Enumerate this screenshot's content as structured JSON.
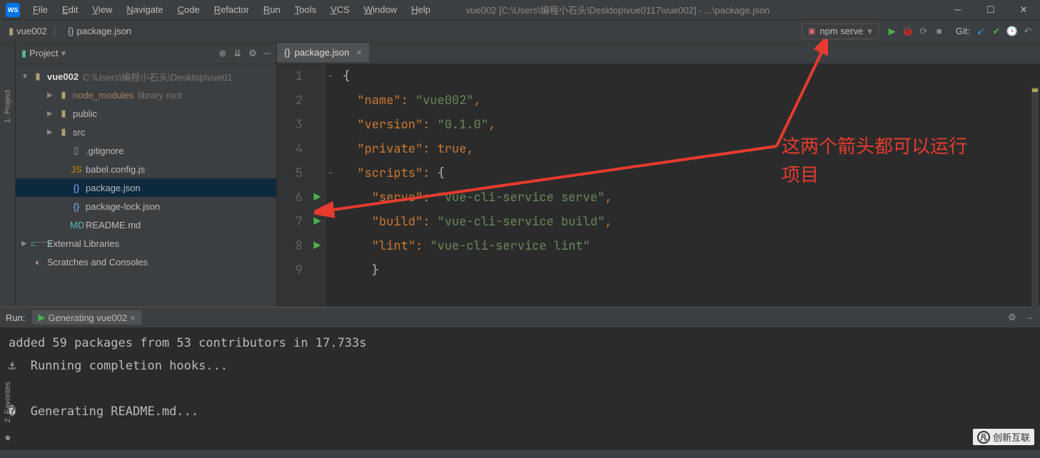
{
  "menu": {
    "items": [
      "File",
      "Edit",
      "View",
      "Navigate",
      "Code",
      "Refactor",
      "Run",
      "Tools",
      "VCS",
      "Window",
      "Help"
    ]
  },
  "window_title": "vue002 [C:\\Users\\编程小石头\\Desktop\\vue0117\\vue002] - ...\\package.json",
  "breadcrumb": {
    "root": "vue002",
    "file": "package.json"
  },
  "run_config": "npm serve",
  "git_label": "Git:",
  "project": {
    "title": "Project",
    "root": {
      "name": "vue002",
      "path": "C:\\Users\\编程小石头\\Desktop\\vue01"
    },
    "items": [
      {
        "label": "node_modules",
        "suffix": "library root",
        "indent": 2,
        "kind": "folder",
        "expandable": true,
        "lib": true
      },
      {
        "label": "public",
        "indent": 2,
        "kind": "folder",
        "expandable": true
      },
      {
        "label": "src",
        "indent": 2,
        "kind": "folder",
        "expandable": true
      },
      {
        "label": ".gitignore",
        "indent": 3,
        "kind": "file"
      },
      {
        "label": "babel.config.js",
        "indent": 3,
        "kind": "jsfile"
      },
      {
        "label": "package.json",
        "indent": 3,
        "kind": "jsonfile",
        "selected": true
      },
      {
        "label": "package-lock.json",
        "indent": 3,
        "kind": "jsonfile"
      },
      {
        "label": "README.md",
        "indent": 3,
        "kind": "mdfile"
      }
    ],
    "extlib": "External Libraries",
    "scratches": "Scratches and Consoles"
  },
  "editor": {
    "tab": "package.json",
    "lines": [
      {
        "n": 1,
        "mark": "",
        "fold": "–",
        "html": "<span class='s-brace'>{</span>"
      },
      {
        "n": 2,
        "mark": "",
        "fold": "",
        "html": "  <span class='s-key'>\"name\"</span><span class='s-pun'>: </span><span class='s-str'>\"vue002\"</span><span class='s-pun'>,</span>"
      },
      {
        "n": 3,
        "mark": "",
        "fold": "",
        "html": "  <span class='s-key'>\"version\"</span><span class='s-pun'>: </span><span class='s-str'>\"0.1.0\"</span><span class='s-pun'>,</span>"
      },
      {
        "n": 4,
        "mark": "",
        "fold": "",
        "html": "  <span class='s-key'>\"private\"</span><span class='s-pun'>: </span><span class='s-bool'>true</span><span class='s-pun'>,</span>"
      },
      {
        "n": 5,
        "mark": "",
        "fold": "–",
        "html": "  <span class='s-key'>\"scripts\"</span><span class='s-pun'>: </span><span class='s-brace'>{</span>"
      },
      {
        "n": 6,
        "mark": "▶",
        "fold": "",
        "html": "    <span class='s-key'>\"serve\"</span><span class='s-pun'>: </span><span class='s-str'>\"vue-cli-service serve\"</span><span class='s-pun'>,</span>"
      },
      {
        "n": 7,
        "mark": "▶",
        "fold": "",
        "html": "    <span class='s-key'>\"build\"</span><span class='s-pun'>: </span><span class='s-str'>\"vue-cli-service build\"</span><span class='s-pun'>,</span>"
      },
      {
        "n": 8,
        "mark": "▶",
        "fold": "",
        "html": "    <span class='s-key'>\"lint\"</span><span class='s-pun'>: </span><span class='s-str'>\"vue-cli-service lint\"</span>"
      },
      {
        "n": 9,
        "mark": "",
        "fold": "",
        "html": "    <span class='s-brace'>}</span>"
      }
    ]
  },
  "run_panel": {
    "label": "Run:",
    "tab": "Generating vue002",
    "lines": [
      "added 59 packages from 53 contributors in 17.733s",
      "⚓  Running completion hooks...",
      "",
      "�  Generating README.md...",
      ""
    ]
  },
  "annotation": {
    "text1": "这两个箭头都可以运行",
    "text2": "项目"
  },
  "side_labels": {
    "project": "1: Project",
    "fav": "2: Favorites"
  },
  "watermark": "创新互联"
}
